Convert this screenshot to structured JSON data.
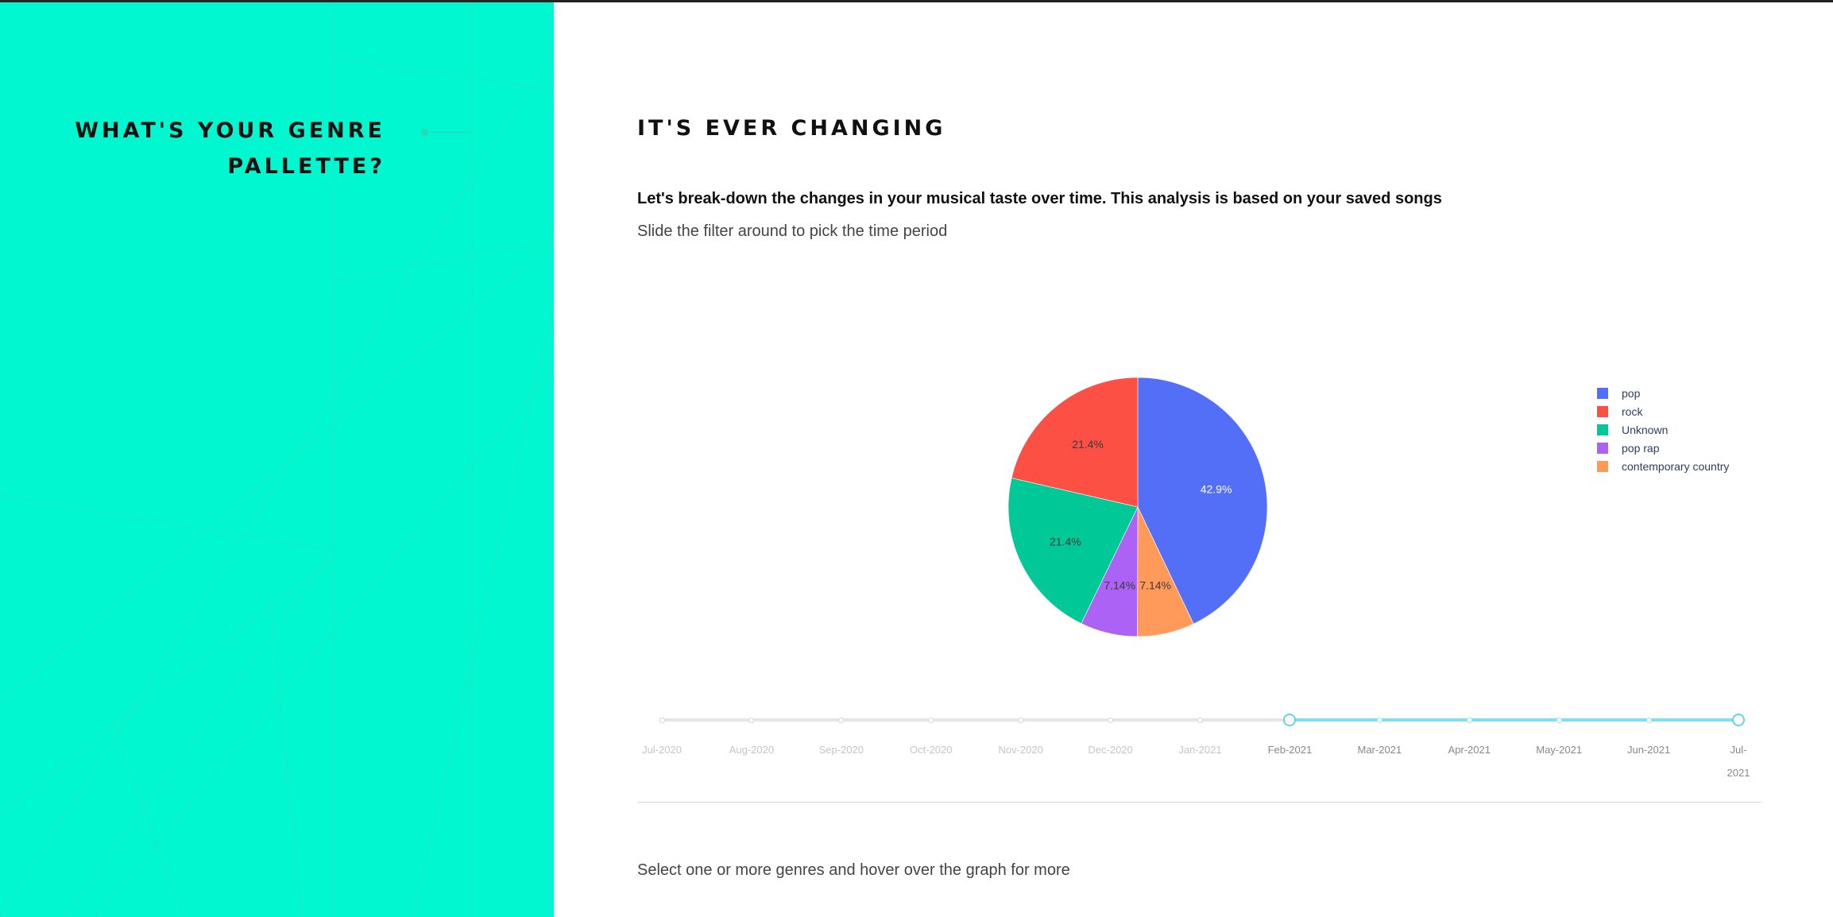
{
  "left_panel": {
    "title_line1": "WHAT'S YOUR GENRE",
    "title_line2": "PALLETTE?"
  },
  "main": {
    "section_title": "IT'S EVER CHANGING",
    "intro": "Let's break-down the changes in your musical taste over time. This analysis is based on your saved songs",
    "hint": "Slide the filter around to pick the time period",
    "footer": "Select one or more genres and hover over the graph for more"
  },
  "chart_data": {
    "type": "pie",
    "slices": [
      {
        "label": "pop",
        "value": 42.9,
        "text": "42.9%",
        "color": "#536ef7"
      },
      {
        "label": "contemporary country",
        "value": 7.14,
        "text": "7.14%",
        "color": "#ff9a5a"
      },
      {
        "label": "pop rap",
        "value": 7.14,
        "text": "7.14%",
        "color": "#ab62f5"
      },
      {
        "label": "Unknown",
        "value": 21.4,
        "text": "21.4%",
        "color": "#00c897"
      },
      {
        "label": "rock",
        "value": 21.4,
        "text": "21.4%",
        "color": "#fd5045"
      }
    ],
    "legend_order": [
      "pop",
      "rock",
      "Unknown",
      "pop rap",
      "contemporary country"
    ],
    "legend_position": "top-right"
  },
  "slider": {
    "marks": [
      "Jul-2020",
      "Aug-2020",
      "Sep-2020",
      "Oct-2020",
      "Nov-2020",
      "Dec-2020",
      "Jan-2021",
      "Feb-2021",
      "Mar-2021",
      "Apr-2021",
      "May-2021",
      "Jun-2021",
      "Jul-2021"
    ],
    "range_start": "Feb-2021",
    "range_end": "Jul-2021",
    "accent_color": "#7fdff0"
  }
}
